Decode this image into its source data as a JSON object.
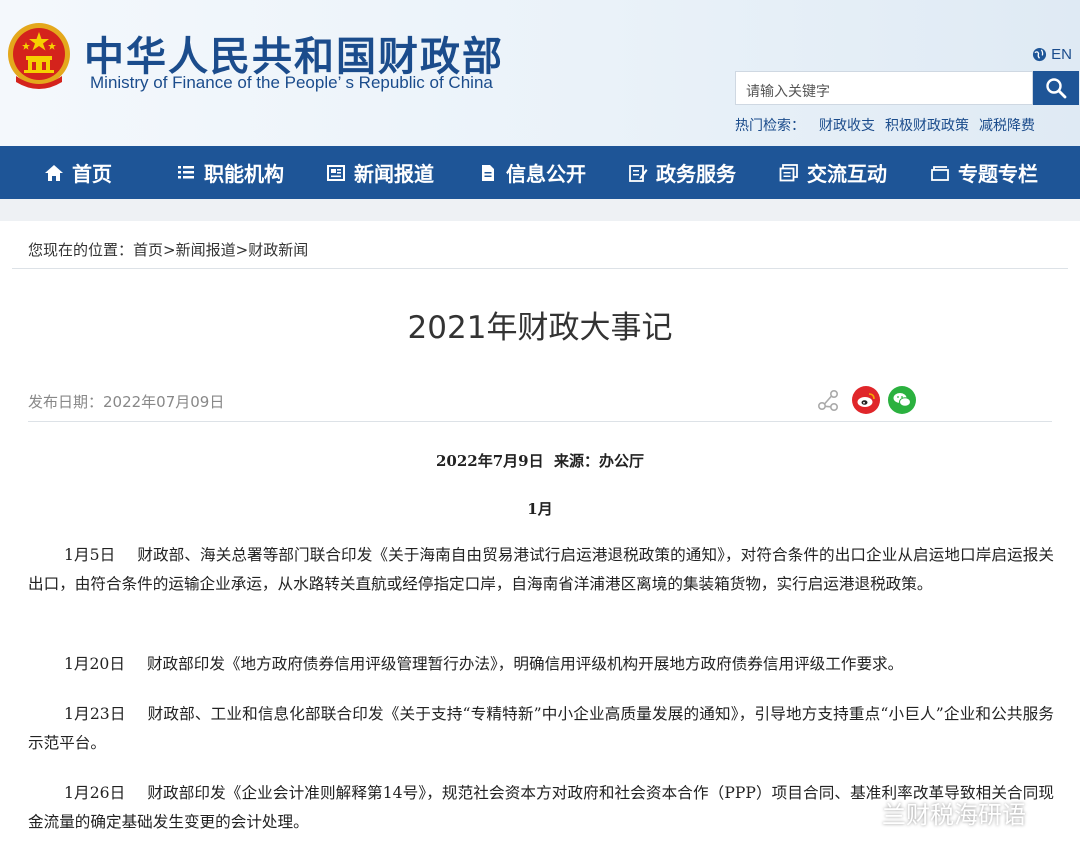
{
  "header": {
    "title_cn": "中华人民共和国财政部",
    "title_en": "Ministry of Finance of the People’ s Republic of China",
    "lang_label": "EN",
    "search_placeholder": "请输入关键字",
    "hot_label": "热门检索：",
    "hot_items": [
      "财政收支",
      "积极财政政策",
      "减税降费"
    ]
  },
  "nav": [
    {
      "label": "首页",
      "icon": "home-icon"
    },
    {
      "label": "职能机构",
      "icon": "list-icon"
    },
    {
      "label": "新闻报道",
      "icon": "news-icon"
    },
    {
      "label": "信息公开",
      "icon": "document-icon"
    },
    {
      "label": "政务服务",
      "icon": "edit-icon"
    },
    {
      "label": "交流互动",
      "icon": "chat-icon"
    },
    {
      "label": "专题专栏",
      "icon": "folder-icon"
    }
  ],
  "breadcrumb": {
    "prefix": "您现在的位置：",
    "items": [
      "首页",
      "新闻报道",
      "财政新闻"
    ]
  },
  "article": {
    "title": "2021年财政大事记",
    "pub_date": "发布日期：2022年07月09日",
    "source_line": "2022年7月9日  来源：办公厅",
    "month": "1月",
    "entries": [
      {
        "date": "1月5日",
        "text": "财政部、海关总署等部门联合印发《关于海南自由贸易港试行启运港退税政策的通知》，对符合条件的出口企业从启运地口岸启运报关出口，由符合条件的运输企业承运，从水路转关直航或经停指定口岸，自海南省洋浦港区离境的集装箱货物，实行启运港退税政策。"
      },
      {
        "date": "1月20日",
        "text": "财政部印发《地方政府债券信用评级管理暂行办法》，明确信用评级机构开展地方政府债券信用评级工作要求。"
      },
      {
        "date": "1月23日",
        "text": "财政部、工业和信息化部联合印发《关于支持“专精特新”中小企业高质量发展的通知》，引导地方支持重点“小巨人”企业和公共服务示范平台。"
      },
      {
        "date": "1月26日",
        "text": "财政部印发《企业会计准则解释第14号》，规范社会资本方对政府和社会资本合作（PPP）项目合同、基准利率改革导致相关合同现金流量的确定基础发生变更的会计处理。"
      }
    ]
  },
  "watermark": "兰财税海研语",
  "colors": {
    "nav_bg": "#1e5597",
    "brand": "#1b4c8c",
    "weibo": "#e0262a",
    "wechat": "#2bb13f"
  }
}
